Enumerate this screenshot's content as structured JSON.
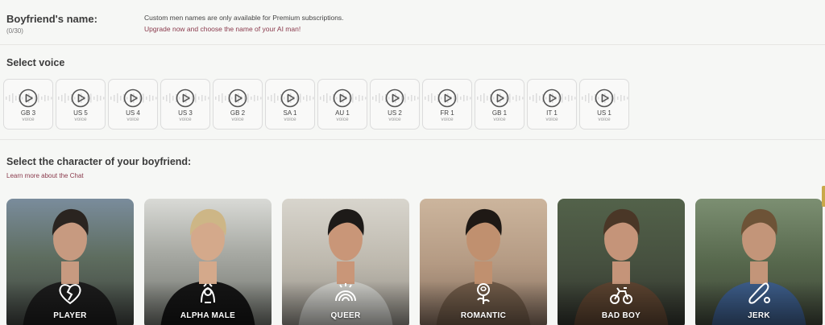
{
  "name_section": {
    "title": "Boyfriend's name:",
    "counter": "(0/30)",
    "premium_note": "Custom men names are only available for Premium subscriptions.",
    "upgrade_link": "Upgrade now and choose the name of your AI man!"
  },
  "voice_section": {
    "title": "Select voice",
    "voices": [
      {
        "code": "GB 3",
        "sub": "voice"
      },
      {
        "code": "US 5",
        "sub": "voice"
      },
      {
        "code": "US 4",
        "sub": "voice"
      },
      {
        "code": "US 3",
        "sub": "voice"
      },
      {
        "code": "GB 2",
        "sub": "voice"
      },
      {
        "code": "SA 1",
        "sub": "voice"
      },
      {
        "code": "AU 1",
        "sub": "voice"
      },
      {
        "code": "US 2",
        "sub": "voice"
      },
      {
        "code": "FR 1",
        "sub": "voice"
      },
      {
        "code": "GB 1",
        "sub": "voice"
      },
      {
        "code": "IT 1",
        "sub": "voice"
      },
      {
        "code": "US 1",
        "sub": "voice"
      }
    ]
  },
  "character_section": {
    "title": "Select the character of your boyfriend:",
    "learn_link": "Learn more about the Chat",
    "characters": [
      {
        "label": "PLAYER",
        "icon": "broken-heart-icon"
      },
      {
        "label": "ALPHA MALE",
        "icon": "lion-icon"
      },
      {
        "label": "QUEER",
        "icon": "rainbow-icon"
      },
      {
        "label": "ROMANTIC",
        "icon": "rose-icon"
      },
      {
        "label": "BAD BOY",
        "icon": "motorcycle-icon"
      },
      {
        "label": "JERK",
        "icon": "baseball-bat-icon"
      }
    ]
  },
  "colors": {
    "accent_link": "#8a3a4c",
    "page_bg": "#f6f7f5"
  }
}
